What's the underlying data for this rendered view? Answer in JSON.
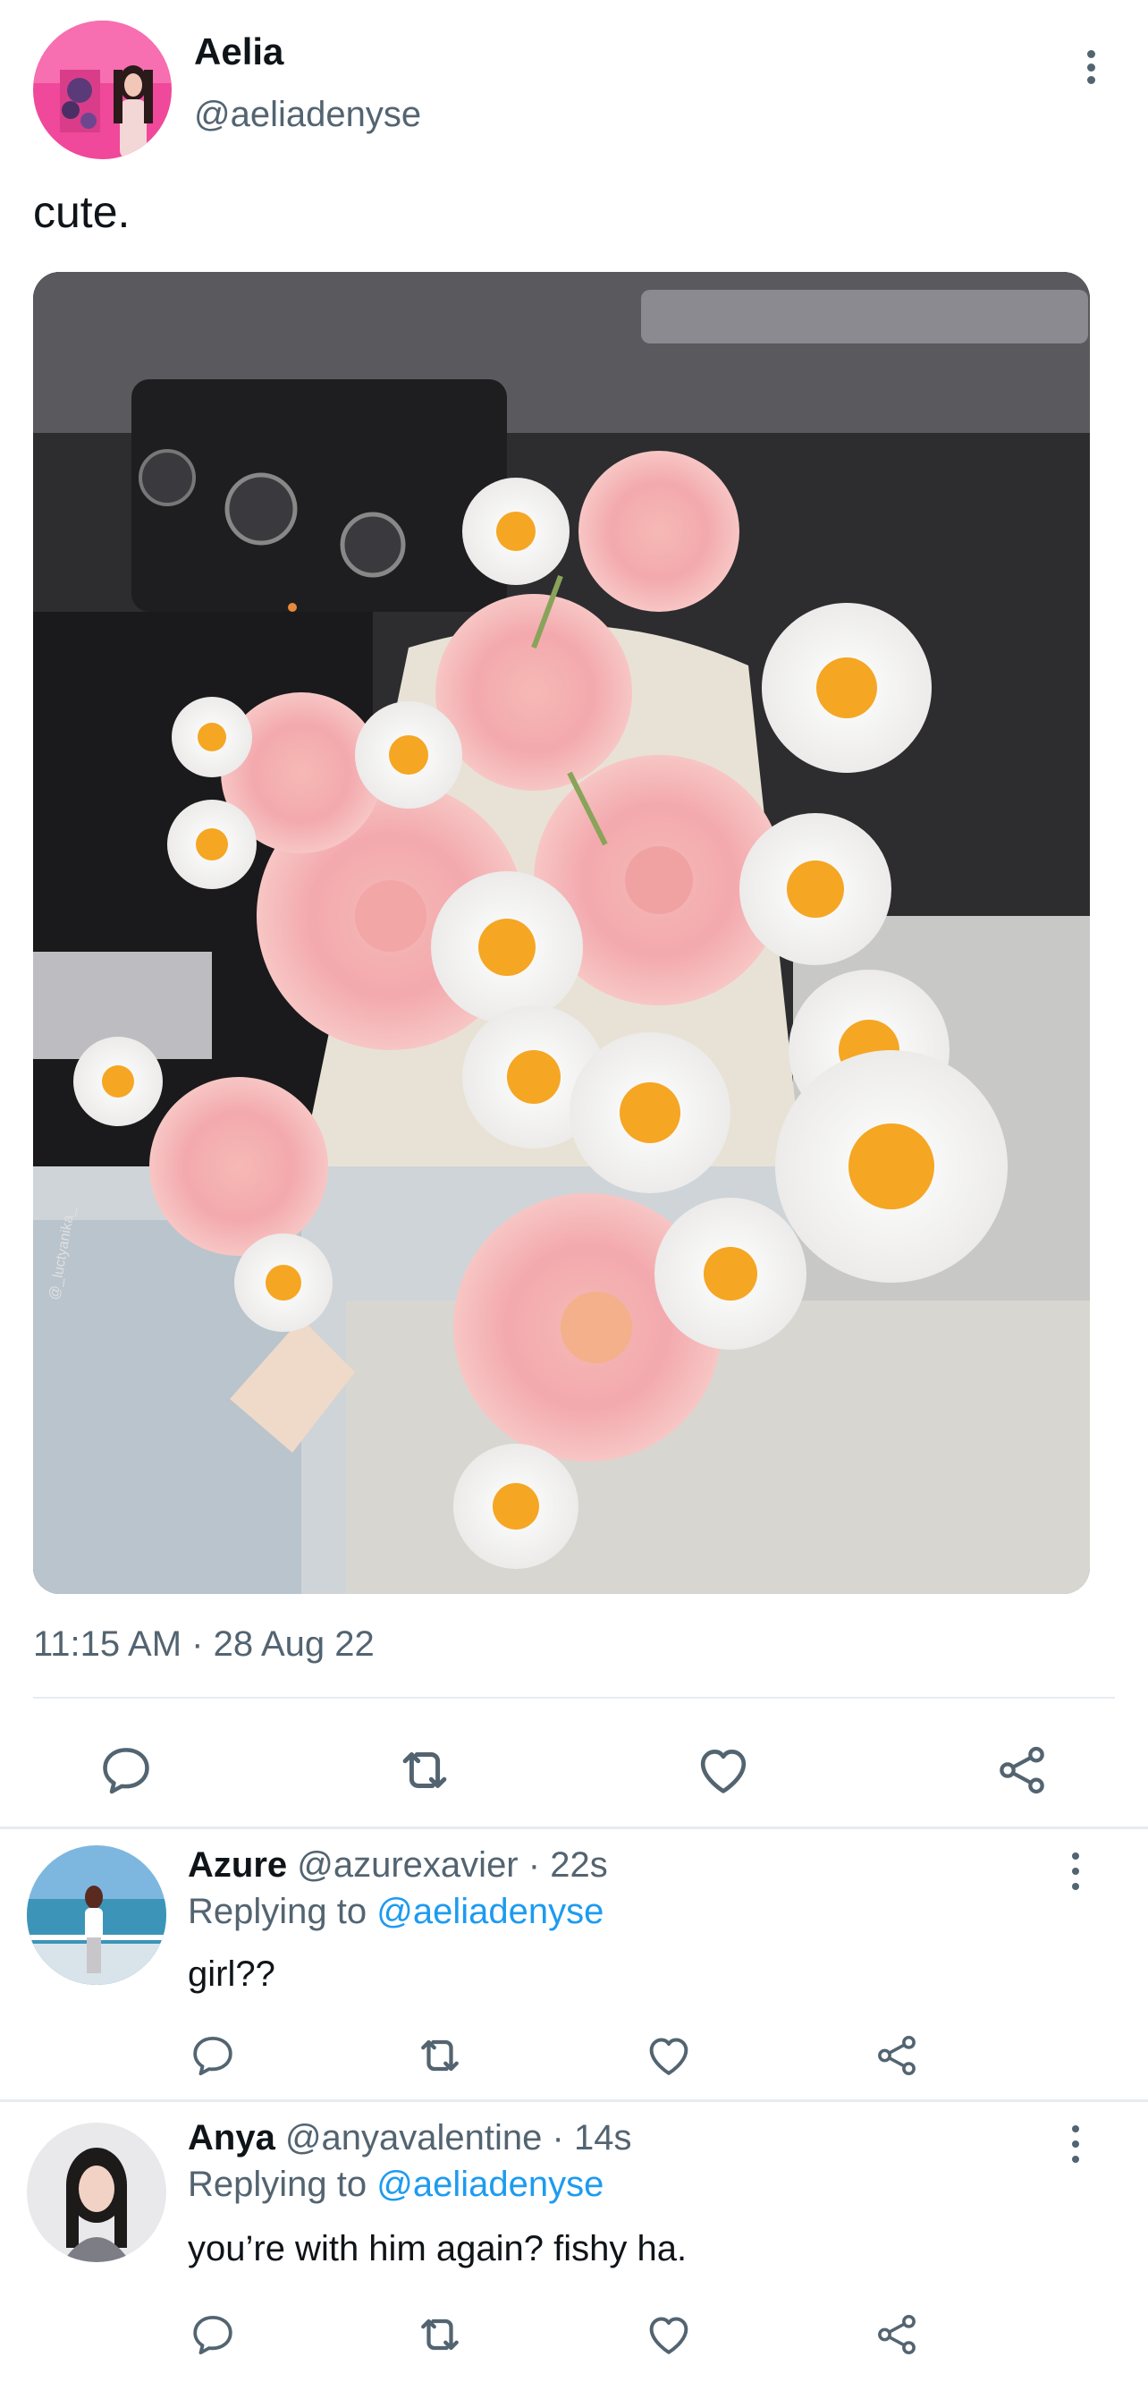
{
  "tweet": {
    "author_name": "Aelia",
    "author_handle": "@aeliadenyse",
    "text": "cute.",
    "timestamp": "11:15 AM · 28 Aug 22",
    "media_watermark": "@_luctyanika_"
  },
  "icons": {
    "reply": "reply-icon",
    "retweet": "retweet-icon",
    "like": "heart-icon",
    "share": "share-icon",
    "more": "more-vertical-icon"
  },
  "colors": {
    "accent": "#1d9bf0",
    "secondary_text": "#536471",
    "divider": "#e6ecf0"
  },
  "replies": [
    {
      "name": "Azure",
      "handle": "@azurexavier",
      "time": "· 22s",
      "replying_prefix": "Replying to",
      "replying_to": "@aeliadenyse",
      "text": "girl??"
    },
    {
      "name": "Anya",
      "handle": "@anyavalentine",
      "time": "· 14s",
      "replying_prefix": "Replying to",
      "replying_to": "@aeliadenyse",
      "text": "you’re with him again? fishy ha."
    }
  ]
}
